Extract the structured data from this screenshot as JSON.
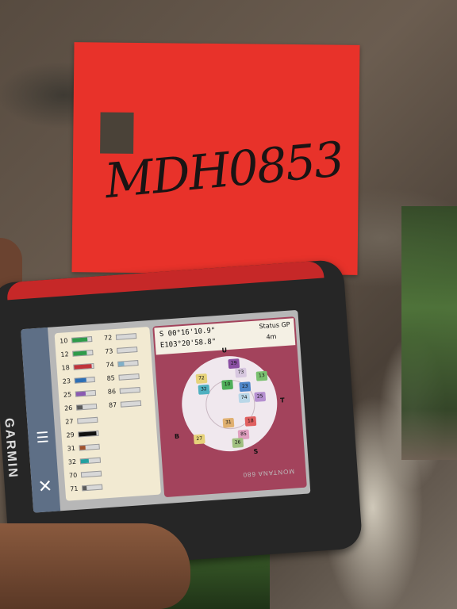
{
  "tag": {
    "text": "MDH0853"
  },
  "device": {
    "brand": "GARMIN",
    "model": "MONTANA 680",
    "coords": {
      "lat": "S  00°16'10.9\"",
      "lon": "E103°20'58.8\""
    },
    "status_label": "Status GP",
    "accuracy": "4m",
    "satellites_left": [
      {
        "id": "10",
        "color": "#2e9b4a",
        "level": 0.8
      },
      {
        "id": "12",
        "color": "#2e9b4a",
        "level": 0.7
      },
      {
        "id": "18",
        "color": "#c0333a",
        "level": 0.9
      },
      {
        "id": "23",
        "color": "#2d6fb5",
        "level": 0.6
      },
      {
        "id": "25",
        "color": "#8a5ab2",
        "level": 0.5
      },
      {
        "id": "26",
        "color": "#5a5a5a",
        "level": 0.3
      },
      {
        "id": "27",
        "color": "#cfcfcf",
        "level": 0.0
      },
      {
        "id": "29",
        "color": "#111111",
        "level": 0.9
      },
      {
        "id": "31",
        "color": "#a0522d",
        "level": 0.3
      },
      {
        "id": "32",
        "color": "#23a0a0",
        "level": 0.4
      },
      {
        "id": "70",
        "color": "#cfcfcf",
        "level": 0.0
      },
      {
        "id": "71",
        "color": "#5a5a5a",
        "level": 0.2
      }
    ],
    "satellites_right": [
      {
        "id": "72",
        "color": "#cfcfcf",
        "level": 0.0
      },
      {
        "id": "73",
        "color": "#cfcfcf",
        "level": 0.0
      },
      {
        "id": "74",
        "color": "#7fb0c9",
        "level": 0.3
      },
      {
        "id": "85",
        "color": "#cfcfcf",
        "level": 0.0
      },
      {
        "id": "86",
        "color": "#cfcfcf",
        "level": 0.0
      },
      {
        "id": "87",
        "color": "#cfcfcf",
        "level": 0.0
      }
    ],
    "compass": {
      "n": "U",
      "e": "T",
      "s": "S",
      "w": "B"
    },
    "skyplot_sats": [
      {
        "id": "72",
        "color": "#e6d27a"
      },
      {
        "id": "29",
        "color": "#8a4fa3"
      },
      {
        "id": "73",
        "color": "#d8c8e0"
      },
      {
        "id": "32",
        "color": "#4fb0c0"
      },
      {
        "id": "10",
        "color": "#4faf5a"
      },
      {
        "id": "23",
        "color": "#4f86c9"
      },
      {
        "id": "13",
        "color": "#7ac070"
      },
      {
        "id": "74",
        "color": "#b9d7e8"
      },
      {
        "id": "25",
        "color": "#b58fd0"
      },
      {
        "id": "31",
        "color": "#e0b070"
      },
      {
        "id": "18",
        "color": "#e06060"
      },
      {
        "id": "85",
        "color": "#e0a0c0"
      },
      {
        "id": "27",
        "color": "#e6d27a"
      },
      {
        "id": "26",
        "color": "#a0c080"
      }
    ],
    "icons": {
      "menu": "menu-icon",
      "close": "close-icon"
    }
  }
}
